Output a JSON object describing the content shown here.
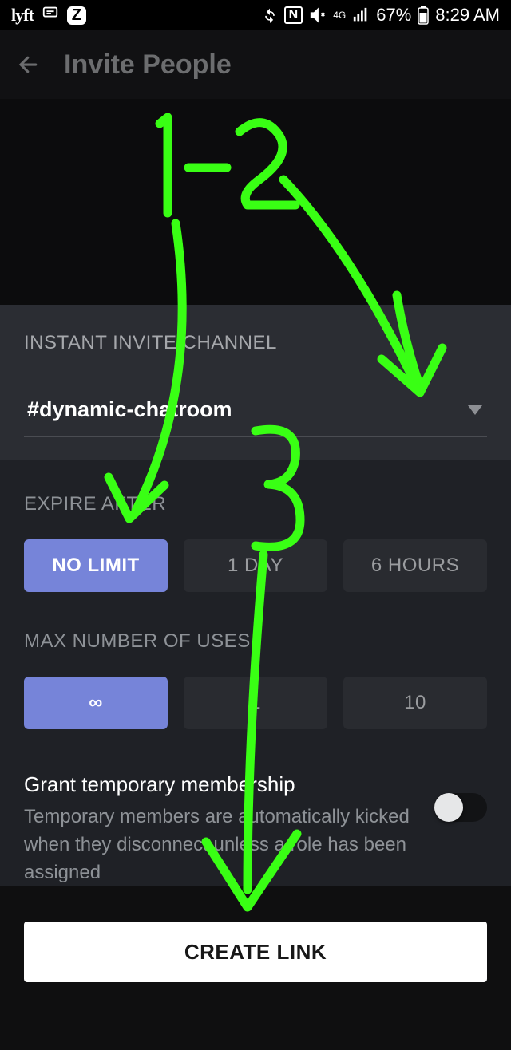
{
  "status": {
    "lyft": "lyft",
    "z": "Z",
    "nfc": "N",
    "signal_label": "4G",
    "battery": "67%",
    "time": "8:29 AM"
  },
  "header": {
    "title": "Invite People"
  },
  "channel": {
    "section_label": "INSTANT INVITE CHANNEL",
    "selected": "#dynamic-chatroom"
  },
  "expire": {
    "label": "EXPIRE AFTER",
    "options": [
      "NO LIMIT",
      "1 DAY",
      "6 HOURS"
    ],
    "selected_index": 0
  },
  "max_uses": {
    "label": "MAX NUMBER OF USES",
    "options": [
      "∞",
      "1",
      "10"
    ],
    "selected_index": 0
  },
  "temp_membership": {
    "title": "Grant temporary membership",
    "desc": "Temporary members are automatically kicked when they disconnect unless a role has been assigned",
    "enabled": false
  },
  "create_button": "CREATE LINK"
}
